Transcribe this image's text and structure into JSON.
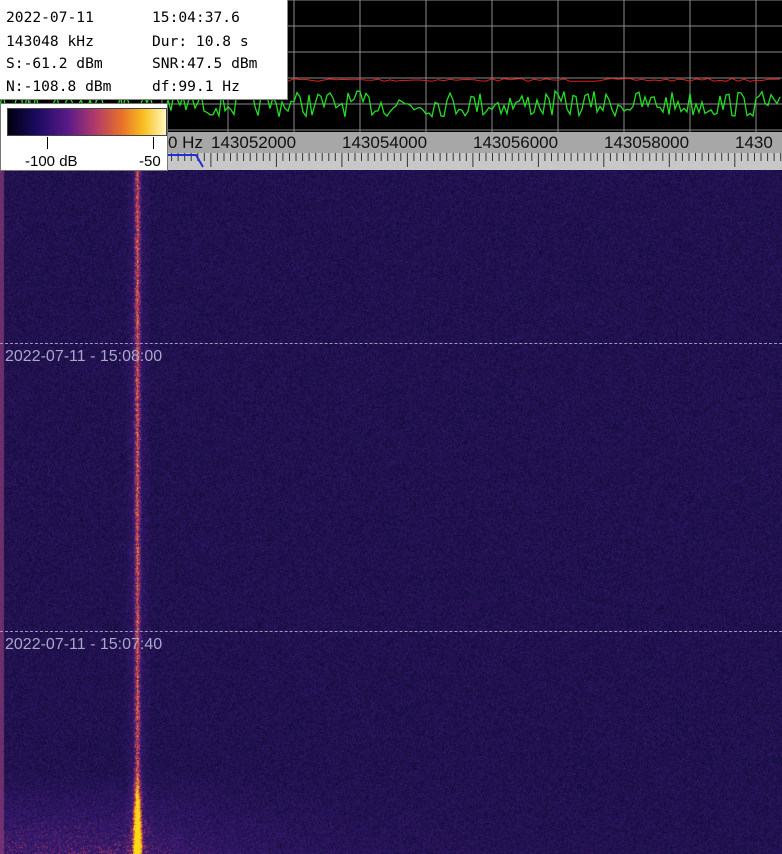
{
  "info": {
    "date": "2022-07-11",
    "time": "15:04:37.6",
    "frequency": "143048 kHz",
    "duration": "Dur: 10.8 s",
    "signal": "S:-61.2 dBm",
    "snr": "SNR:47.5 dBm",
    "noise": "N:-108.8 dBm",
    "df": "df:99.1 Hz"
  },
  "colorbar": {
    "min_label": "-100 dB",
    "max_label": "-50"
  },
  "freq_axis": {
    "labels": [
      {
        "text": "0 Hz"
      },
      {
        "text": "143052000"
      },
      {
        "text": "143054000"
      },
      {
        "text": "143056000"
      },
      {
        "text": "143058000"
      },
      {
        "text": "1430"
      }
    ]
  },
  "waterfall": {
    "timestamps": [
      {
        "text": "2022-07-11 - 15:08:00"
      },
      {
        "text": "2022-07-11 - 15:07:40"
      }
    ]
  },
  "colors": {
    "spectrum_trace": "#22e022",
    "noise_trace": "#e02020",
    "grid": "#8a8a8a",
    "waterfall_base": "#1c1650",
    "signal_core": "#ffb000"
  }
}
